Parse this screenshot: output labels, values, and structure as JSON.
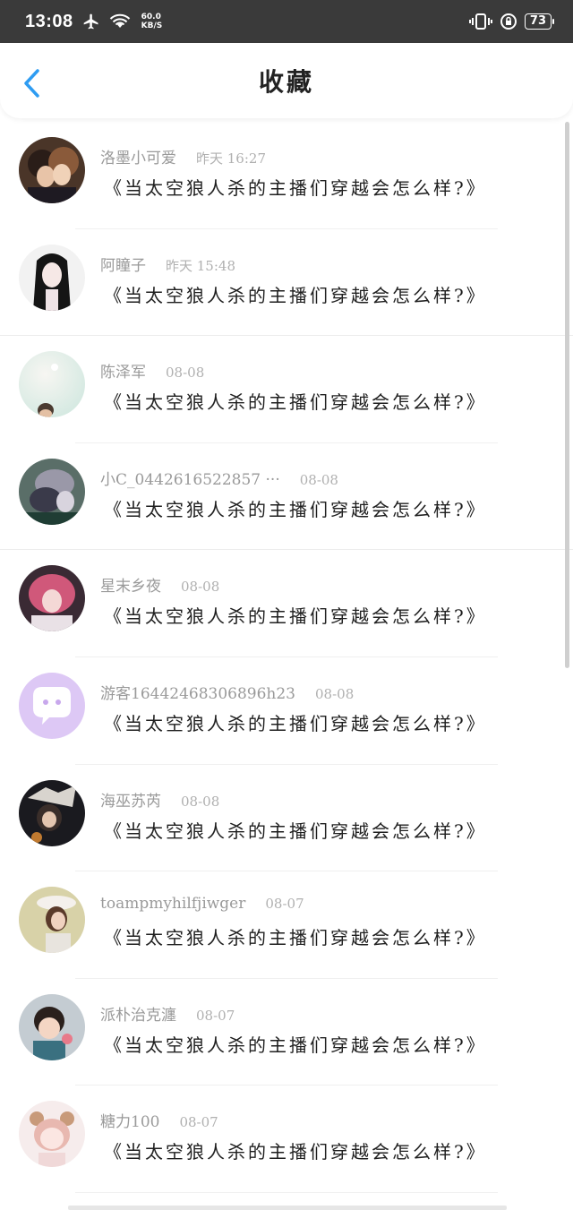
{
  "status_bar": {
    "time": "13:08",
    "speed_value": "60.0",
    "speed_unit": "KB/S",
    "battery": "73"
  },
  "header": {
    "title": "收藏"
  },
  "colors": {
    "accent": "#2e9cf2",
    "status_bar_bg": "#3a3a3a"
  },
  "favorites": [
    {
      "name": "洛墨小可爱",
      "time": "昨天 16:27",
      "message": "《当太空狼人杀的主播们穿越会怎么样?》",
      "avatar": "anime-duo-avatar"
    },
    {
      "name": "阿瞳子",
      "time": "昨天 15:48",
      "message": "《当太空狼人杀的主播们穿越会怎么样?》",
      "avatar": "black-hair-girl-avatar"
    },
    {
      "name": "陈泽军",
      "time": "08-08",
      "message": "《当太空狼人杀的主播们穿越会怎么样?》",
      "avatar": "photo-avatar"
    },
    {
      "name": "小C_0442616522857 ···",
      "time": "08-08",
      "message": "《当太空狼人杀的主播们穿越会怎么样?》",
      "avatar": "grey-character-avatar"
    },
    {
      "name": "星末乡夜",
      "time": "08-08",
      "message": "《当太空狼人杀的主播们穿越会怎么样?》",
      "avatar": "pink-hair-girl-avatar"
    },
    {
      "name": "游客1644246830689​6h23",
      "time": "08-08",
      "message": "《当太空狼人杀的主播们穿越会怎么样?》",
      "avatar": "default-chat-avatar"
    },
    {
      "name": "海巫苏芮",
      "time": "08-08",
      "message": "《当太空狼人杀的主播们穿越会怎么样?》",
      "avatar": "dark-character-avatar"
    },
    {
      "name": "toampmyhilfjiwger",
      "time": "08-07",
      "message": "《当太空狼人杀的主播们穿越会怎么样?》",
      "avatar": "hat-girl-avatar"
    },
    {
      "name": "派朴治克瀍",
      "time": "08-07",
      "message": "《当太空狼人杀的主播们穿越会怎么样?》",
      "avatar": "child-photo-avatar"
    },
    {
      "name": "糖力100",
      "time": "08-07",
      "message": "《当太空狼人杀的主播们穿越会怎么样?》",
      "avatar": "cute-chibi-avatar"
    }
  ]
}
